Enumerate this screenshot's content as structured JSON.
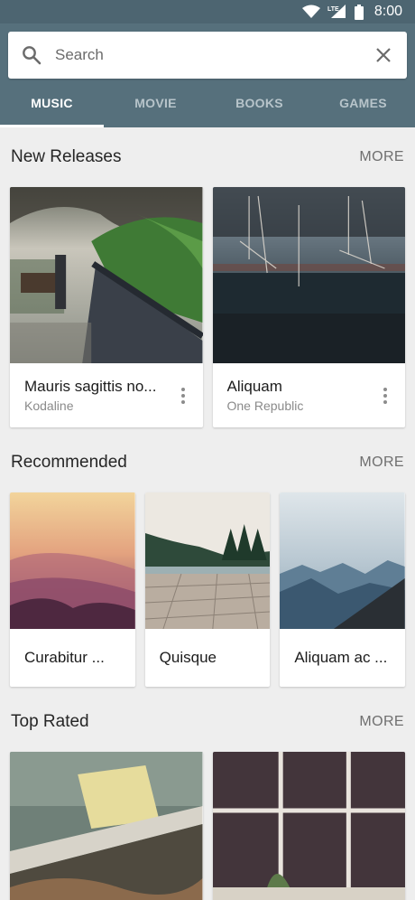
{
  "status_bar": {
    "time": "8:00",
    "network": "LTE"
  },
  "search": {
    "placeholder": "Search"
  },
  "tabs": [
    {
      "label": "MUSIC",
      "active": true
    },
    {
      "label": "MOVIE",
      "active": false
    },
    {
      "label": "BOOKS",
      "active": false
    },
    {
      "label": "GAMES",
      "active": false
    }
  ],
  "sections": {
    "new_releases": {
      "title": "New Releases",
      "more": "MORE",
      "items": [
        {
          "title": "Mauris sagittis no...",
          "subtitle": "Kodaline"
        },
        {
          "title": "Aliquam",
          "subtitle": "One Republic"
        }
      ]
    },
    "recommended": {
      "title": "Recommended",
      "more": "MORE",
      "items": [
        {
          "title": "Curabitur ..."
        },
        {
          "title": "Quisque"
        },
        {
          "title": "Aliquam ac ..."
        }
      ]
    },
    "top_rated": {
      "title": "Top Rated",
      "more": "MORE"
    }
  },
  "colors": {
    "header": "#56707c",
    "status_bar": "#4d6571",
    "background": "#eeeeee"
  }
}
